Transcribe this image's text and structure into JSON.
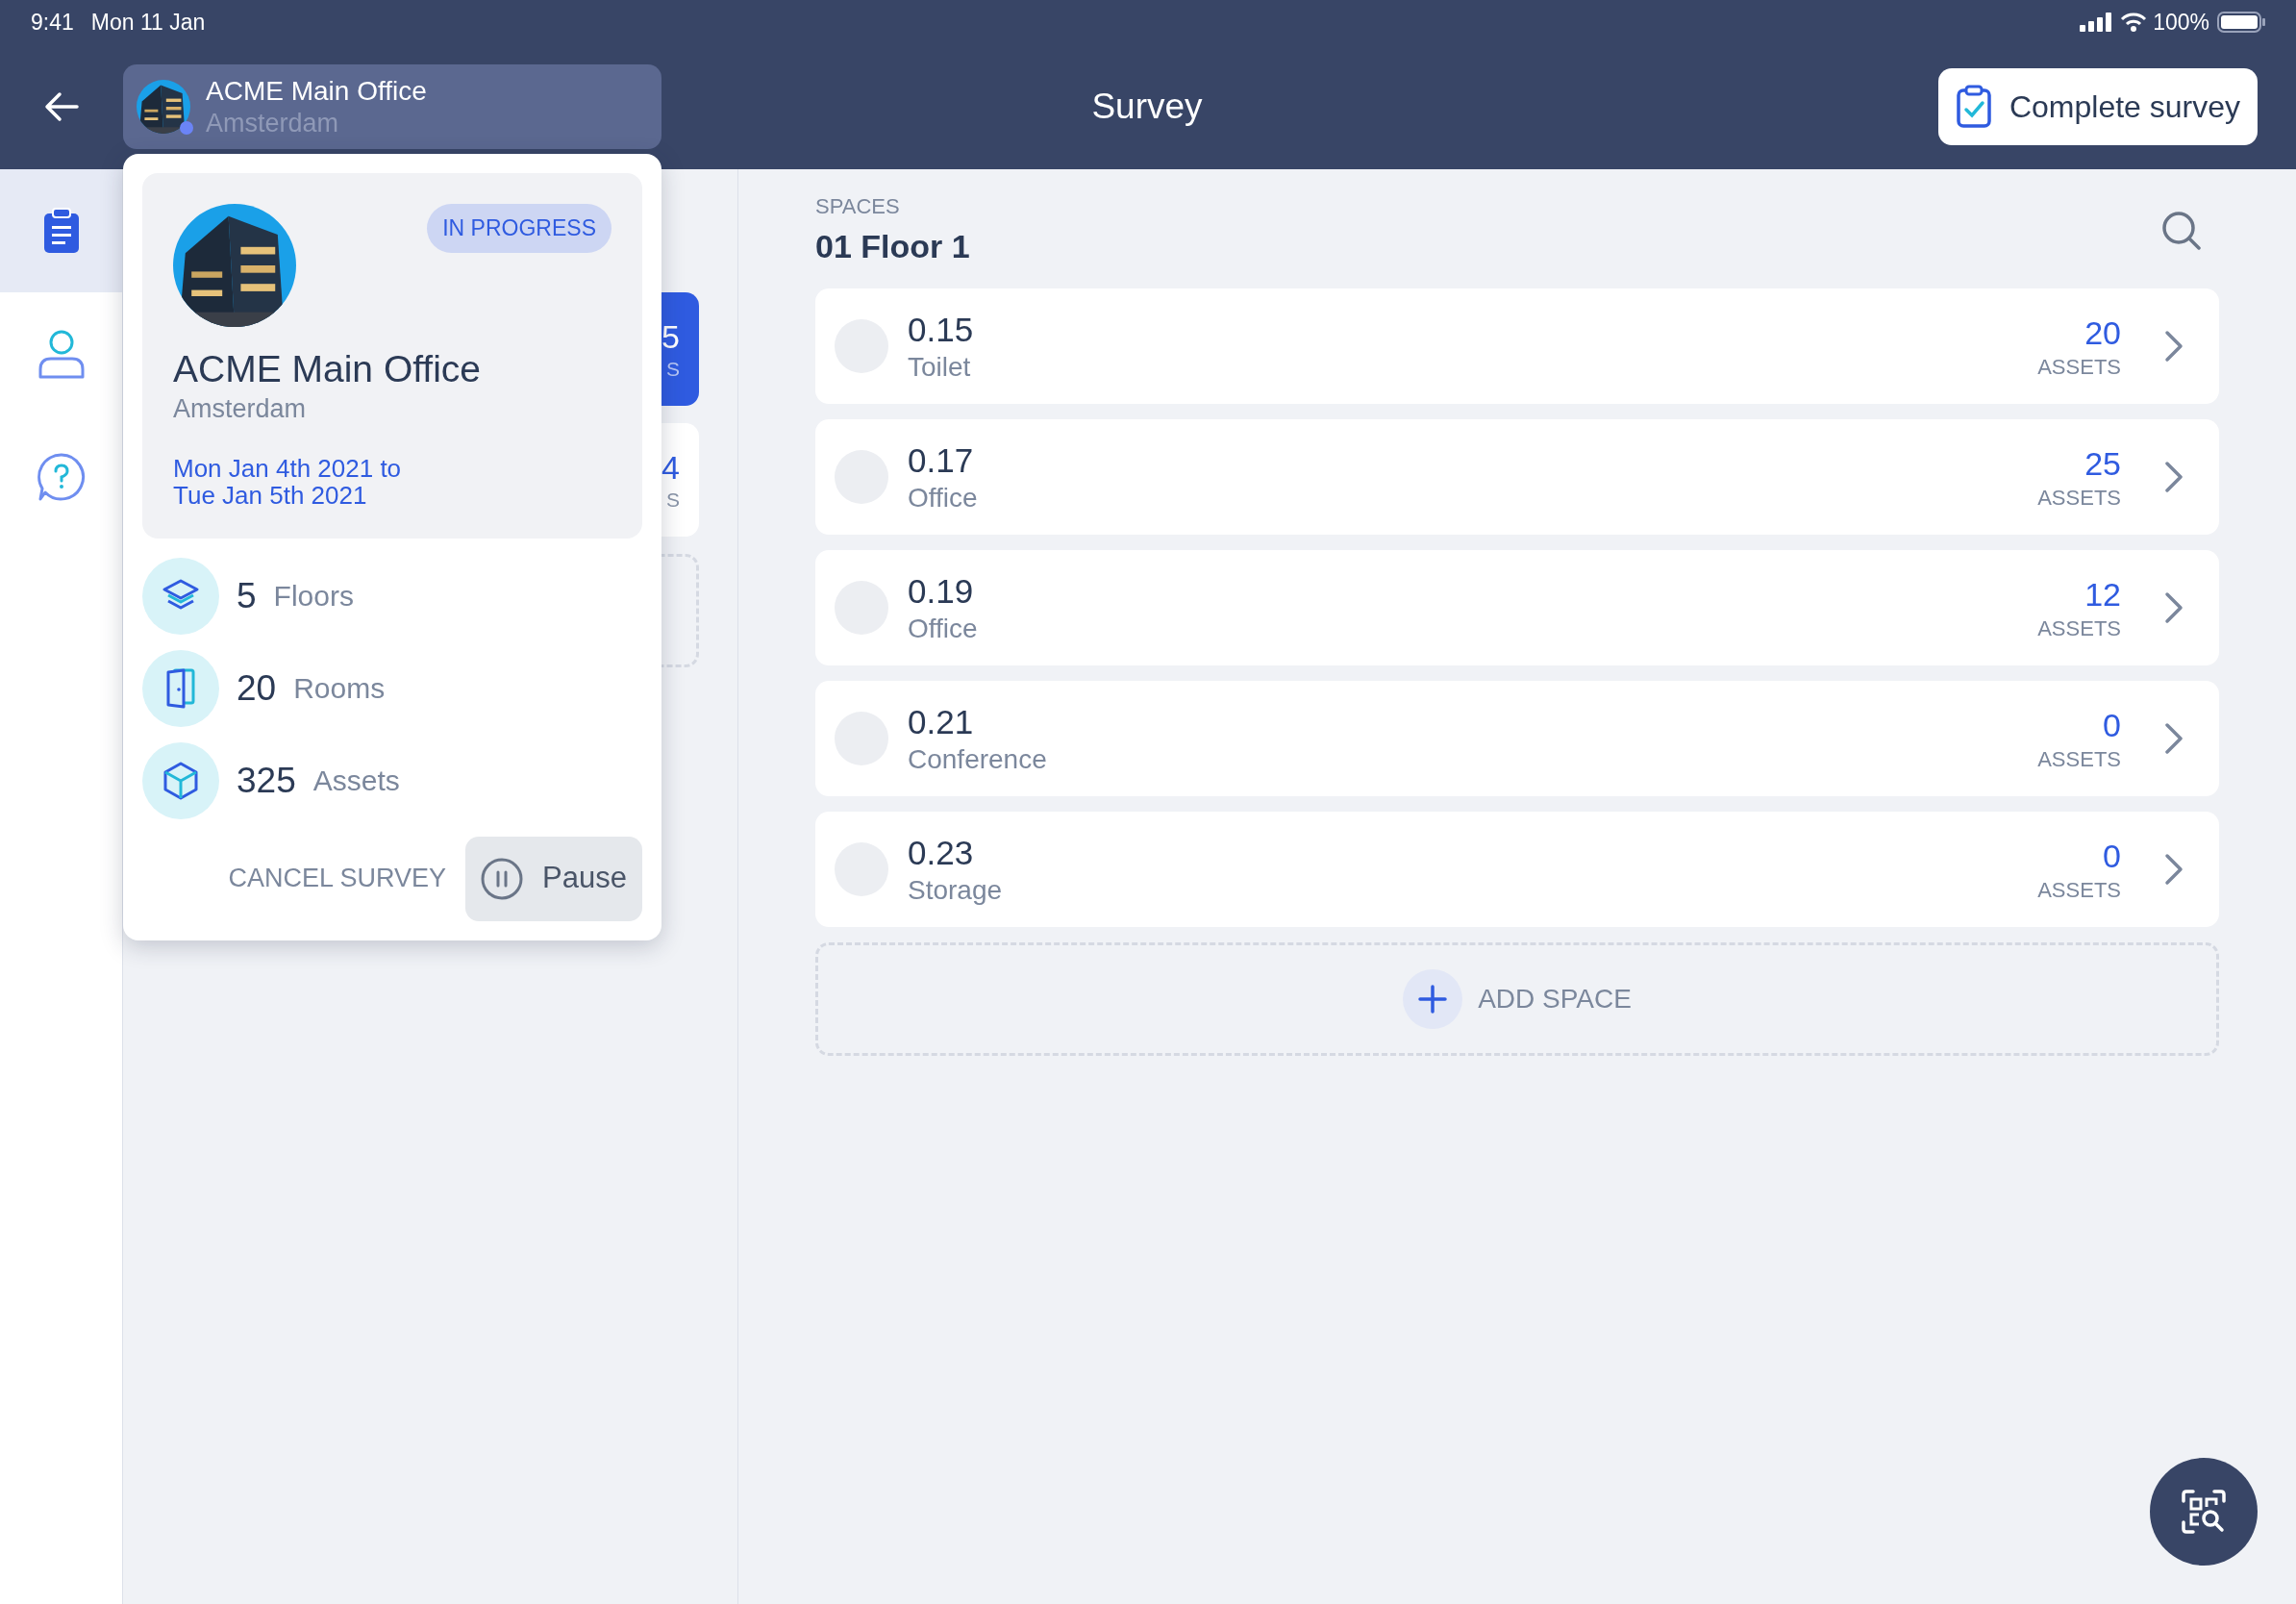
{
  "status_bar": {
    "time": "9:41",
    "date": "Mon 11 Jan",
    "battery": "100%"
  },
  "header": {
    "location": {
      "name": "ACME Main Office",
      "city": "Amsterdam"
    },
    "title": "Survey",
    "complete_button": "Complete survey"
  },
  "rail": [
    {
      "kind": "clipboard",
      "selected": true
    },
    {
      "kind": "person",
      "selected": false
    },
    {
      "kind": "help",
      "selected": false
    }
  ],
  "floor_cards": [
    {
      "kind": "card",
      "count": "5",
      "label": "S",
      "selected": true
    },
    {
      "kind": "card",
      "count": "4",
      "label": "S",
      "selected": false
    },
    {
      "kind": "add"
    }
  ],
  "popover": {
    "status": "IN PROGRESS",
    "name": "ACME Main Office",
    "city": "Amsterdam",
    "date_lines": [
      "Mon Jan 4th 2021 to",
      "Tue Jan 5th 2021"
    ],
    "stats": [
      {
        "kind": "floors",
        "count": "5",
        "label": "Floors"
      },
      {
        "kind": "rooms",
        "count": "20",
        "label": "Rooms"
      },
      {
        "kind": "assets",
        "count": "325",
        "label": "Assets"
      }
    ],
    "cancel_button": "CANCEL SURVEY",
    "pause_button": "Pause"
  },
  "spaces": {
    "heading": "SPACES",
    "floor": "01 Floor 1",
    "rows": [
      {
        "number": "0.15",
        "type": "Toilet",
        "count": "20",
        "count_label": "ASSETS"
      },
      {
        "number": "0.17",
        "type": "Office",
        "count": "25",
        "count_label": "ASSETS"
      },
      {
        "number": "0.19",
        "type": "Office",
        "count": "12",
        "count_label": "ASSETS"
      },
      {
        "number": "0.21",
        "type": "Conference",
        "count": "0",
        "count_label": "ASSETS"
      },
      {
        "number": "0.23",
        "type": "Storage",
        "count": "0",
        "count_label": "ASSETS"
      }
    ],
    "add_button": "ADD SPACE"
  }
}
